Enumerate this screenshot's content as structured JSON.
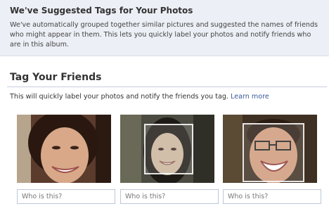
{
  "banner": {
    "title": "We've Suggested Tags for Your Photos",
    "description": "We've automatically grouped together similar pictures and suggested the names of friends who might appear in them. This lets you quickly label your photos and notify friends who are in this album."
  },
  "tag_section": {
    "title": "Tag Your Friends",
    "subtext": "This will quickly label your photos and notify the friends you tag.",
    "learn_more": "Learn more"
  },
  "cards": [
    {
      "name_placeholder": "Who is this?"
    },
    {
      "name_placeholder": "Who is this?"
    },
    {
      "name_placeholder": "Who is this?"
    }
  ],
  "colors": {
    "banner_bg": "#eceff5",
    "link": "#3b5998",
    "input_border": "#bdc7d8"
  }
}
